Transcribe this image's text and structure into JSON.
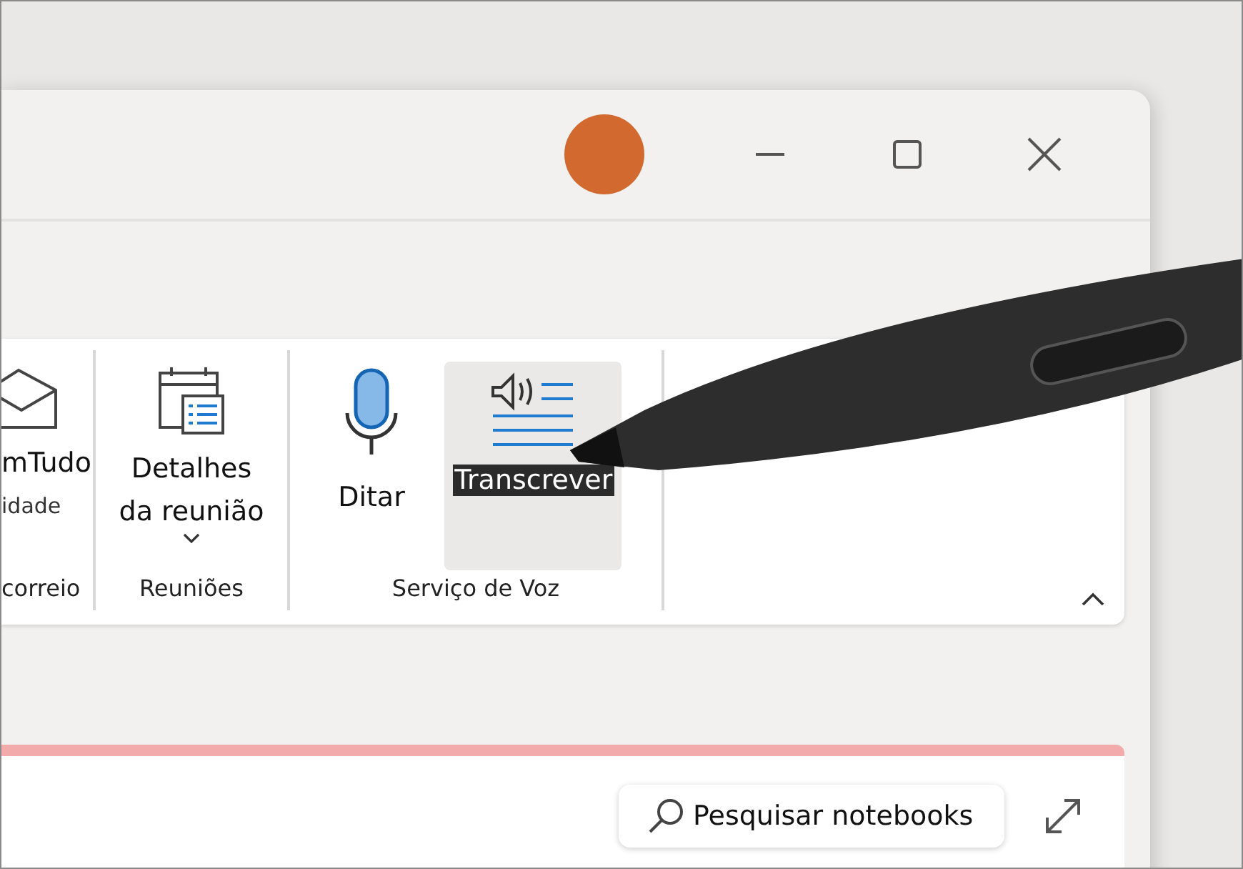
{
  "ribbon": {
    "groups": [
      {
        "label": "correio",
        "buttons": [
          {
            "kind": "envelope",
            "lines": [
              "mTudo",
              "idade"
            ],
            "selected": false,
            "dropdown": false
          }
        ]
      },
      {
        "label": "Reuniões",
        "buttons": [
          {
            "kind": "calendar",
            "lines": [
              "Detalhes",
              "da reunião"
            ],
            "dropdown": true,
            "selected": false
          }
        ]
      },
      {
        "label": "Serviço de Voz",
        "buttons": [
          {
            "kind": "microphone",
            "lines": [
              "Ditar"
            ],
            "dropdown": false,
            "selected": false
          },
          {
            "kind": "transcribe",
            "lines": [
              "Transcrever"
            ],
            "dropdown": false,
            "selected": true
          }
        ]
      }
    ]
  },
  "search": {
    "placeholder": "Pesquisar notebooks"
  }
}
